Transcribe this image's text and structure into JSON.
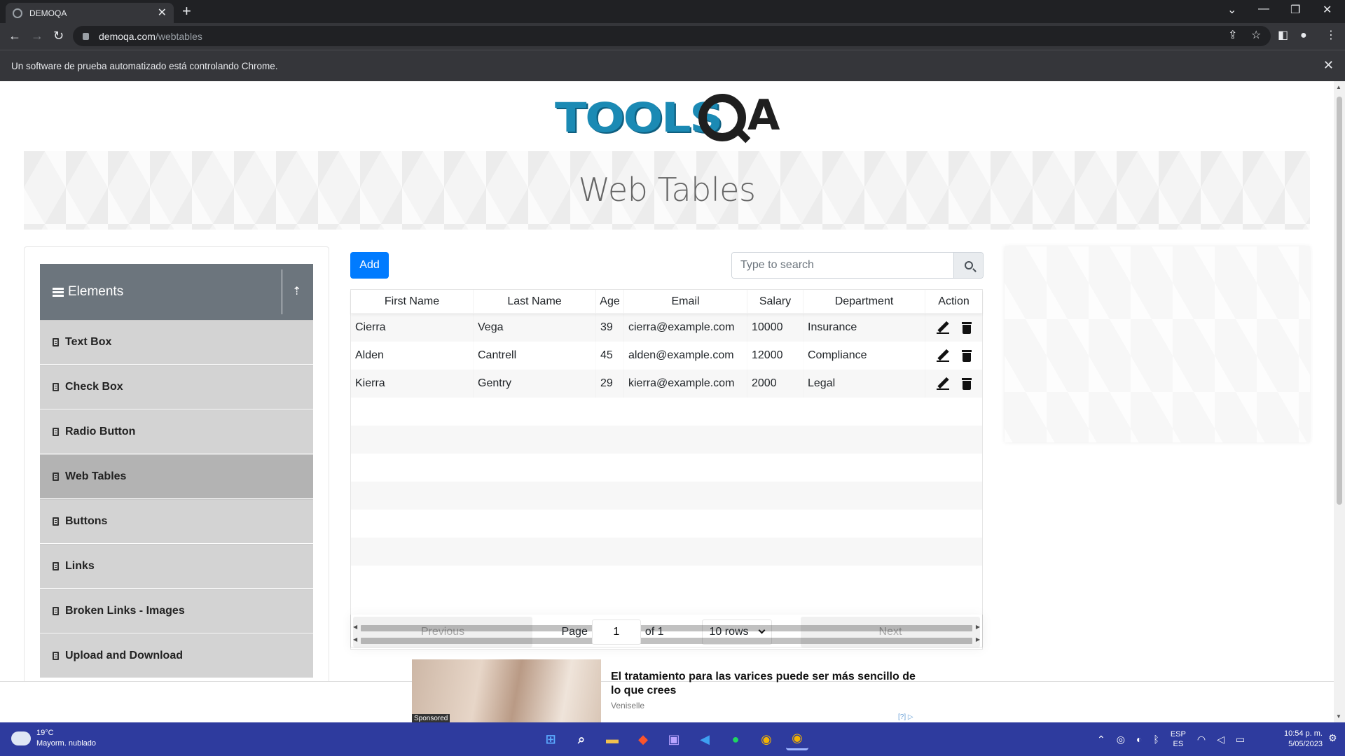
{
  "browser": {
    "tab_title": "DEMOQA",
    "url_domain": "demoqa.com",
    "url_path": "/webtables",
    "automation_notice": "Un software de prueba automatizado está controlando Chrome."
  },
  "page": {
    "logo_text": "TOOLS",
    "logo_suffix": "A",
    "banner_title": "Web Tables"
  },
  "sidebar": {
    "group_title": "Elements",
    "items": [
      {
        "label": "Text Box",
        "active": false
      },
      {
        "label": "Check Box",
        "active": false
      },
      {
        "label": "Radio Button",
        "active": false
      },
      {
        "label": "Web Tables",
        "active": true
      },
      {
        "label": "Buttons",
        "active": false
      },
      {
        "label": "Links",
        "active": false
      },
      {
        "label": "Broken Links - Images",
        "active": false
      },
      {
        "label": "Upload and Download",
        "active": false
      }
    ]
  },
  "toolbar": {
    "add_label": "Add",
    "search_placeholder": "Type to search"
  },
  "table": {
    "columns": [
      "First Name",
      "Last Name",
      "Age",
      "Email",
      "Salary",
      "Department",
      "Action"
    ],
    "rows": [
      {
        "first": "Cierra",
        "last": "Vega",
        "age": "39",
        "email": "cierra@example.com",
        "salary": "10000",
        "department": "Insurance"
      },
      {
        "first": "Alden",
        "last": "Cantrell",
        "age": "45",
        "email": "alden@example.com",
        "salary": "12000",
        "department": "Compliance"
      },
      {
        "first": "Kierra",
        "last": "Gentry",
        "age": "29",
        "email": "kierra@example.com",
        "salary": "2000",
        "department": "Legal"
      }
    ]
  },
  "pagination": {
    "previous_label": "Previous",
    "page_label": "Page",
    "page_value": "1",
    "of_label": "of 1",
    "rows_label": "10 rows",
    "next_label": "Next"
  },
  "ad": {
    "sponsored": "Sponsored",
    "headline": "El tratamiento para las varices puede ser más sencillo de lo que crees",
    "source": "Veniselle",
    "choices": "[?]"
  },
  "taskbar": {
    "temperature": "19°C",
    "weather": "Mayorm. nublado",
    "lang": "ESP",
    "region": "ES",
    "time": "10:54 p. m.",
    "date": "5/05/2023"
  },
  "colors": {
    "primary": "#007bff",
    "sidebar_header": "#6c757d",
    "logo_blue": "#1b8ab4",
    "taskbar": "#2e3b9e"
  }
}
